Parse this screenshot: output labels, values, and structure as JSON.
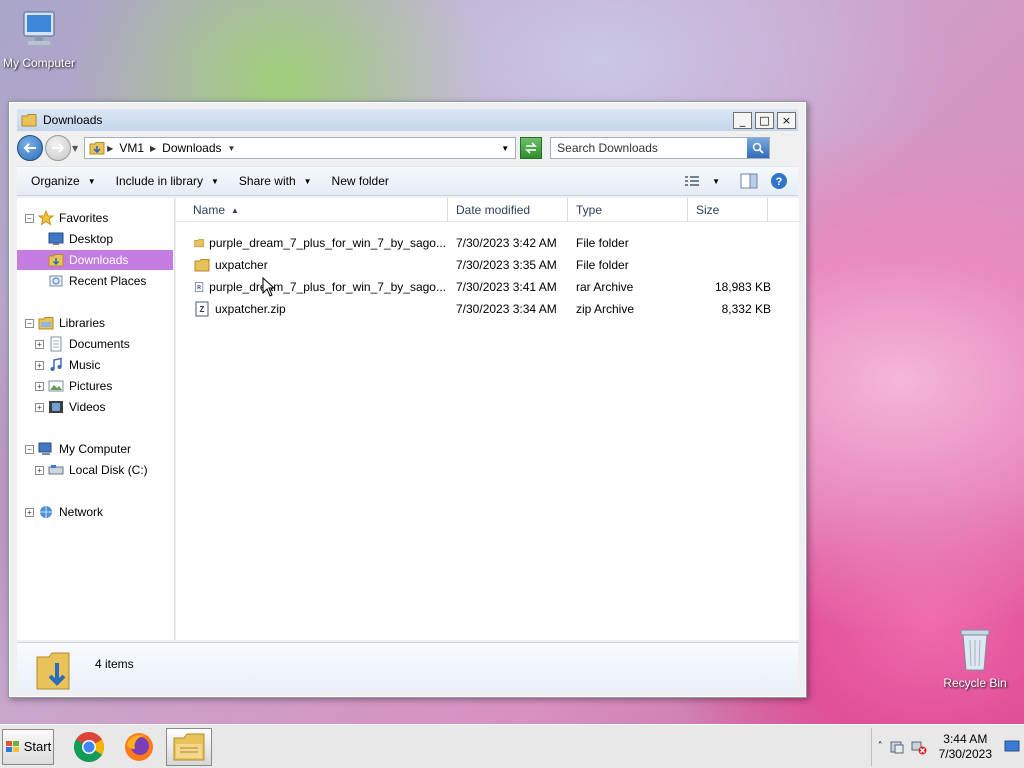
{
  "desktop": {
    "icons": {
      "my_computer": "My Computer",
      "recycle_bin": "Recycle Bin"
    }
  },
  "window": {
    "title": "Downloads",
    "controls": {
      "minimize": "_",
      "maximize": "□",
      "close": "×"
    },
    "address": {
      "segments": [
        "VM1",
        "Downloads"
      ]
    },
    "search": {
      "placeholder": "Search Downloads"
    },
    "toolbar": {
      "organize": "Organize",
      "include_in_library": "Include in library",
      "share_with": "Share with",
      "new_folder": "New folder"
    },
    "nav": {
      "favorites": "Favorites",
      "desktop": "Desktop",
      "downloads": "Downloads",
      "recent_places": "Recent Places",
      "libraries": "Libraries",
      "documents": "Documents",
      "music": "Music",
      "pictures": "Pictures",
      "videos": "Videos",
      "my_computer": "My Computer",
      "local_disk": "Local Disk (C:)",
      "network": "Network"
    },
    "columns": {
      "name": "Name",
      "date": "Date modified",
      "type": "Type",
      "size": "Size"
    },
    "files": [
      {
        "name": "purple_dream_7_plus_for_win_7_by_sago...",
        "date": "7/30/2023 3:42 AM",
        "type": "File folder",
        "size": "",
        "icon": "folder-icon"
      },
      {
        "name": "uxpatcher",
        "date": "7/30/2023 3:35 AM",
        "type": "File folder",
        "size": "",
        "icon": "folder-icon"
      },
      {
        "name": "purple_dream_7_plus_for_win_7_by_sago...",
        "date": "7/30/2023 3:41 AM",
        "type": "rar Archive",
        "size": "18,983 KB",
        "icon": "rar-archive-icon"
      },
      {
        "name": "uxpatcher.zip",
        "date": "7/30/2023 3:34 AM",
        "type": "zip Archive",
        "size": "8,332 KB",
        "icon": "zip-archive-icon"
      }
    ],
    "details": {
      "item_count": "4 items"
    }
  },
  "taskbar": {
    "start": "Start",
    "clock": {
      "time": "3:44 AM",
      "date": "7/30/2023"
    }
  },
  "colors": {
    "selection": "#c37de0",
    "header_text": "#2b3f5c",
    "folder": "#e9c25a"
  }
}
